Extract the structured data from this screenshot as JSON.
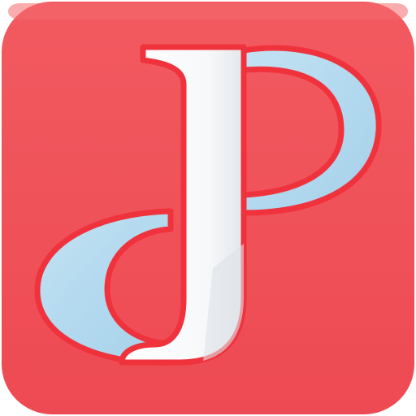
{
  "icon": {
    "monogram": "JP",
    "background_color": "#EF4C55",
    "border_color": "#E04850",
    "outline_color": "#F0323C",
    "ribbon_color": "#B2D9EE",
    "letter_color": "#FFFFFF"
  }
}
